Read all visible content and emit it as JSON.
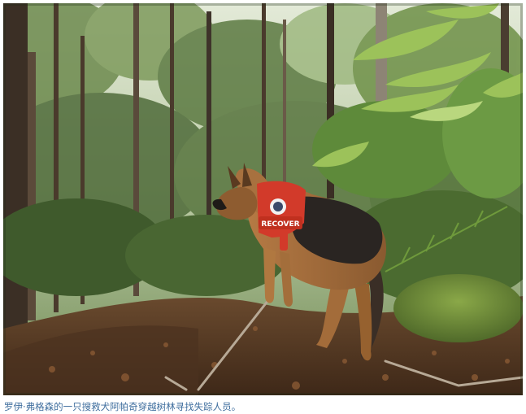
{
  "photo": {
    "harness_text": "RECOVER",
    "colors": {
      "sky": "#d9e3cf",
      "foliage_light": "#8fb860",
      "foliage_dark": "#2f4a26",
      "ground": "#5a3a24",
      "moss": "#6f8f3a",
      "dog_tan": "#a8713f",
      "dog_black": "#2a2522",
      "harness": "#d23a2a"
    }
  },
  "caption": {
    "text": "罗伊·弗格森的一只搜救犬阿帕奇穿越树林寻找失踪人员。"
  }
}
